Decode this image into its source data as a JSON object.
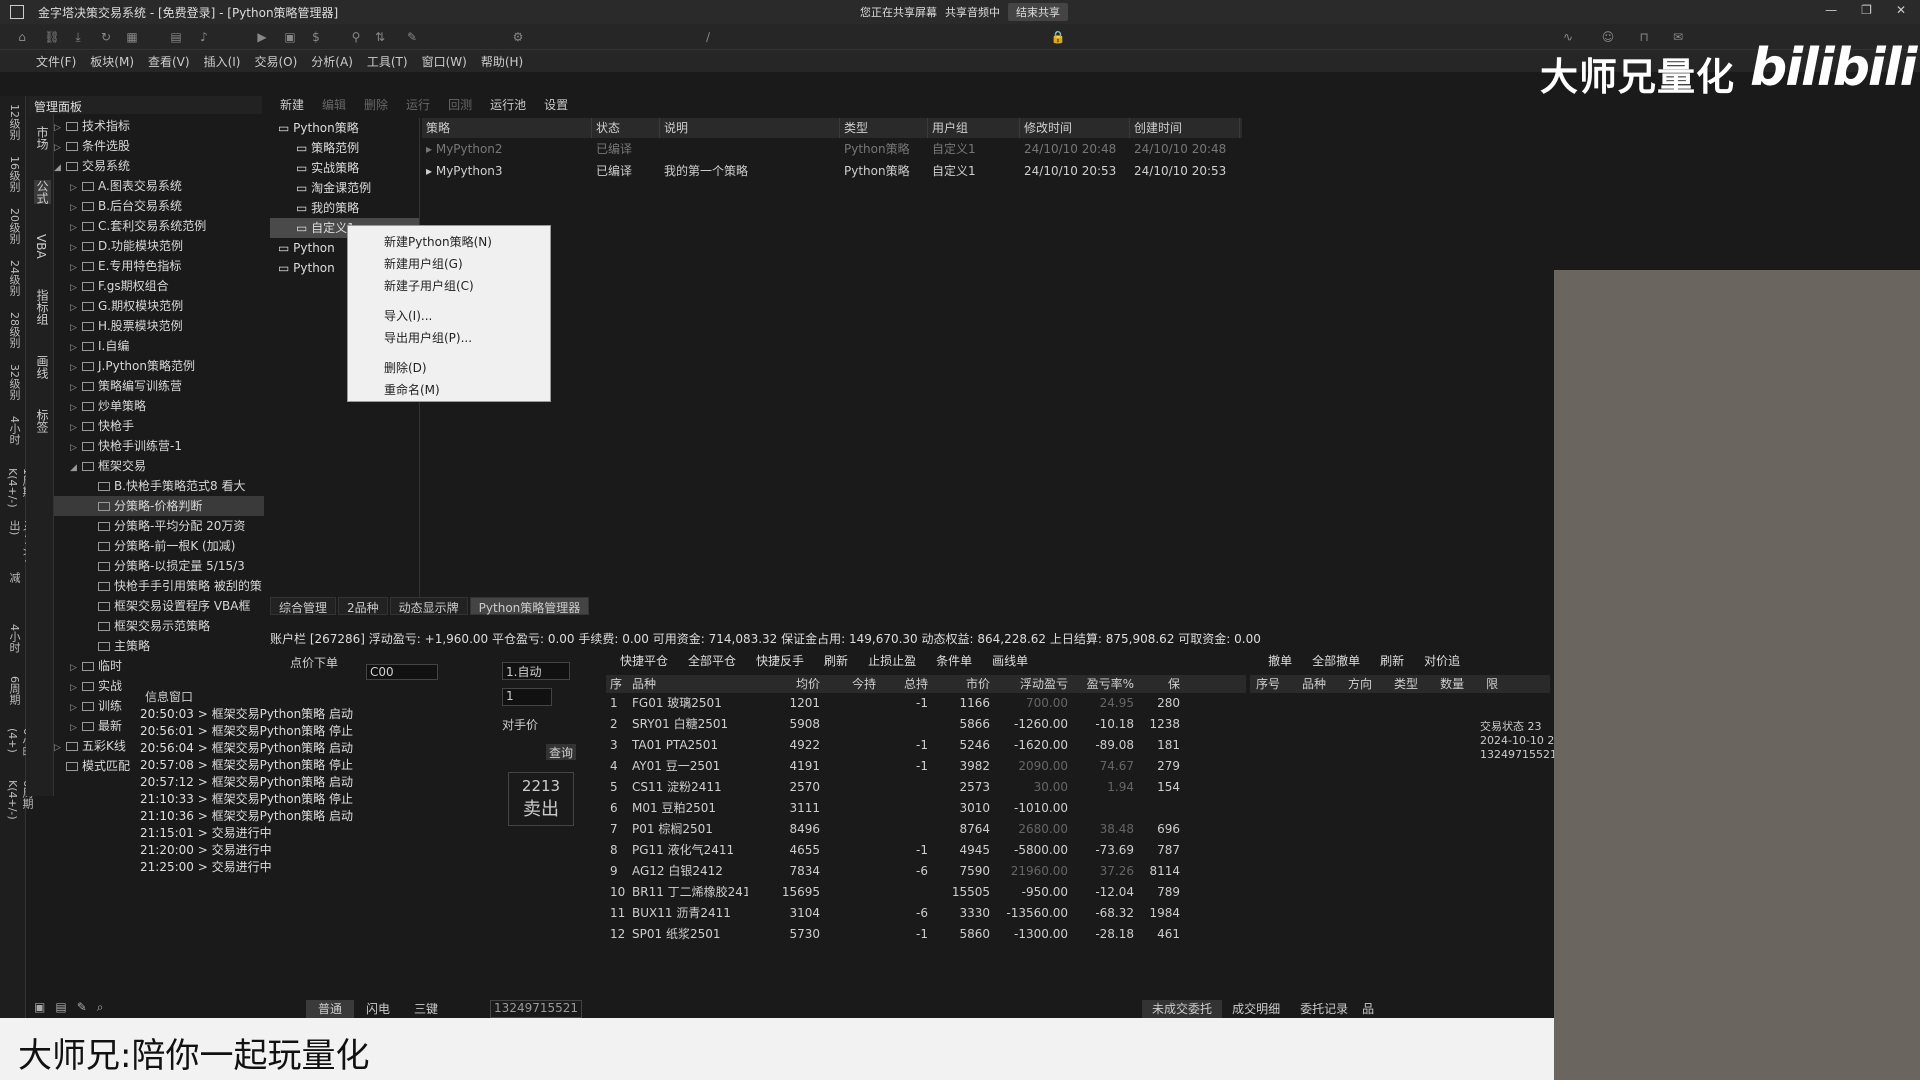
{
  "window": {
    "title": "金字塔决策交易系统 - [免费登录] - [Python策略管理器]"
  },
  "share": {
    "screen": "您正在共享屏幕",
    "audio": "共享音频中",
    "stop": "结束共享"
  },
  "menu": [
    "文件(F)",
    "板块(M)",
    "查看(V)",
    "插入(I)",
    "交易(O)",
    "分析(A)",
    "工具(T)",
    "窗口(W)",
    "帮助(H)"
  ],
  "brand": {
    "name": "大师兄量化",
    "site": "bilibili"
  },
  "left_tabs": [
    "12级别",
    "16级别",
    "20级别",
    "24级别",
    "28级别",
    "32级别",
    "4小时",
    "1周期K(4+/-)",
    "1周期K(4+)(4出)",
    "4小时加减",
    "4小时",
    "6周期",
    "6小时(4+)",
    "6周期K(4+/-)"
  ],
  "panel_tabs": [
    "市场",
    "公式",
    "VBA",
    "指标组",
    "画线",
    "标签"
  ],
  "panel_header": "管理面板",
  "tree": [
    {
      "label": "技术指标",
      "depth": 1,
      "arrow": "▷"
    },
    {
      "label": "条件选股",
      "depth": 1,
      "arrow": "▷"
    },
    {
      "label": "交易系统",
      "depth": 1,
      "arrow": "◢"
    },
    {
      "label": "A.图表交易系统",
      "depth": 2,
      "arrow": "▷"
    },
    {
      "label": "B.后台交易系统",
      "depth": 2,
      "arrow": "▷"
    },
    {
      "label": "C.套利交易系统范例",
      "depth": 2,
      "arrow": "▷"
    },
    {
      "label": "D.功能模块范例",
      "depth": 2,
      "arrow": "▷"
    },
    {
      "label": "E.专用特色指标",
      "depth": 2,
      "arrow": "▷"
    },
    {
      "label": "F.gs期权组合",
      "depth": 2,
      "arrow": "▷"
    },
    {
      "label": "G.期权模块范例",
      "depth": 2,
      "arrow": "▷"
    },
    {
      "label": "H.股票模块范例",
      "depth": 2,
      "arrow": "▷"
    },
    {
      "label": "I.自编",
      "depth": 2,
      "arrow": "▷"
    },
    {
      "label": "J.Python策略范例",
      "depth": 2,
      "arrow": "▷"
    },
    {
      "label": "策略编写训练营",
      "depth": 2,
      "arrow": "▷"
    },
    {
      "label": "炒单策略",
      "depth": 2,
      "arrow": "▷"
    },
    {
      "label": "快枪手",
      "depth": 2,
      "arrow": "▷"
    },
    {
      "label": "快枪手训练营-1",
      "depth": 2,
      "arrow": "▷"
    },
    {
      "label": "框架交易",
      "depth": 2,
      "arrow": "◢"
    },
    {
      "label": "B.快枪手策略范式8 看大",
      "depth": 3,
      "arrow": ""
    },
    {
      "label": "分策略-价格判断",
      "depth": 3,
      "arrow": "",
      "sel": true
    },
    {
      "label": "分策略-平均分配 20万资",
      "depth": 3,
      "arrow": ""
    },
    {
      "label": "分策略-前一根K (加减)",
      "depth": 3,
      "arrow": ""
    },
    {
      "label": "分策略-以损定量 5/15/3",
      "depth": 3,
      "arrow": ""
    },
    {
      "label": "快枪手手引用策略 被刮的策",
      "depth": 3,
      "arrow": ""
    },
    {
      "label": "框架交易设置程序 VBA框",
      "depth": 3,
      "arrow": ""
    },
    {
      "label": "框架交易示范策略",
      "depth": 3,
      "arrow": ""
    },
    {
      "label": "主策略",
      "depth": 3,
      "arrow": ""
    },
    {
      "label": "临时",
      "depth": 2,
      "arrow": "▷"
    },
    {
      "label": "实战",
      "depth": 2,
      "arrow": "▷"
    },
    {
      "label": "训练",
      "depth": 2,
      "arrow": "▷"
    },
    {
      "label": "最新",
      "depth": 2,
      "arrow": "▷"
    },
    {
      "label": "五彩K线",
      "depth": 1,
      "arrow": "▷"
    },
    {
      "label": "模式匹配",
      "depth": 1,
      "arrow": ""
    }
  ],
  "toolbar2": {
    "new": "新建",
    "edit": "编辑",
    "delete": "删除",
    "run": "运行",
    "backtest": "回测",
    "pool": "运行池",
    "settings": "设置"
  },
  "strategy_tree": [
    {
      "label": "Python策略",
      "depth": 0
    },
    {
      "label": "策略范例",
      "depth": 1
    },
    {
      "label": "实战策略",
      "depth": 1
    },
    {
      "label": "淘金课范例",
      "depth": 1
    },
    {
      "label": "我的策略",
      "depth": 1
    },
    {
      "label": "自定义1",
      "depth": 1,
      "sel": true
    },
    {
      "label": "Python",
      "depth": 0
    },
    {
      "label": "Python",
      "depth": 0
    }
  ],
  "strategy_table": {
    "headers": [
      "策略",
      "状态",
      "说明",
      "类型",
      "用户组",
      "修改时间",
      "创建时间"
    ],
    "rows": [
      {
        "cells": [
          "MyPython2",
          "已编译",
          "",
          "Python策略",
          "自定义1",
          "24/10/10 20:48",
          "24/10/10 20:48"
        ],
        "dim": true
      },
      {
        "cells": [
          "MyPython3",
          "已编译",
          "我的第一个策略",
          "Python策略",
          "自定义1",
          "24/10/10 20:53",
          "24/10/10 20:53"
        ],
        "dim": false
      }
    ]
  },
  "context_menu": [
    "新建Python策略(N)",
    "新建用户组(G)",
    "新建子用户组(C)",
    "-",
    "导入(I)...",
    "导出用户组(P)...",
    "-",
    "删除(D)",
    "重命名(M)"
  ],
  "bottom_tabs": [
    "综合管理",
    "2品种",
    "动态显示牌",
    "Python策略管理器"
  ],
  "account": "账户栏 [267286] 浮动盈亏: +1,960.00  平仓盈亏: 0.00  手续费: 0.00  可用资金: 714,083.32  保证金占用: 149,670.30  动态权益: 864,228.62  上日结算: 875,908.62  可取资金: 0.00",
  "order": {
    "label": "点价下单",
    "code": "C00",
    "mode": "1.自动",
    "qty": "1",
    "price_type": "对手价",
    "query": "查询",
    "price": "2213",
    "sell": "卖出"
  },
  "messages": {
    "title": "信息窗口",
    "lines": [
      "20:50:03 > 框架交易Python策略 启动",
      "20:56:01 > 框架交易Python策略 停止",
      "20:56:04 > 框架交易Python策略 启动",
      "20:57:08 > 框架交易Python策略 停止",
      "20:57:12 > 框架交易Python策略 启动",
      "21:10:33 > 框架交易Python策略 停止",
      "21:10:36 > 框架交易Python策略 启动",
      "21:15:01 > 交易进行中",
      "21:20:00 > 交易进行中",
      "21:25:00 > 交易进行中"
    ]
  },
  "position_toolbar": [
    "快捷平仓",
    "全部平仓",
    "快捷反手",
    "刷新",
    "止损止盈",
    "条件单",
    "画线单"
  ],
  "order_toolbar": [
    "撤单",
    "全部撤单",
    "刷新",
    "对价追"
  ],
  "position_headers": [
    "序",
    "品种",
    "均价",
    "今持",
    "总持",
    "市价",
    "浮动盈亏",
    "盈亏率%",
    "保"
  ],
  "positions": [
    [
      "1",
      "FG01 玻璃2501",
      "1201",
      "",
      "-1",
      "1166",
      "700.00",
      "24.95",
      "280"
    ],
    [
      "2",
      "SRY01 白糖2501",
      "5908",
      "",
      "",
      "5866",
      "-1260.00",
      "-10.18",
      "1238"
    ],
    [
      "3",
      "TA01 PTA2501",
      "4922",
      "",
      "-1",
      "5246",
      "-1620.00",
      "-89.08",
      "181"
    ],
    [
      "4",
      "AY01 豆一2501",
      "4191",
      "",
      "-1",
      "3982",
      "2090.00",
      "74.67",
      "279"
    ],
    [
      "5",
      "CS11 淀粉2411",
      "2570",
      "",
      "",
      "2573",
      "30.00",
      "1.94",
      "154"
    ],
    [
      "6",
      "M01 豆粕2501",
      "3111",
      "",
      "",
      "3010",
      "-1010.00",
      "",
      ""
    ],
    [
      "7",
      "P01 棕榈2501",
      "8496",
      "",
      "",
      "8764",
      "2680.00",
      "38.48",
      "696"
    ],
    [
      "8",
      "PG11 液化气2411",
      "4655",
      "",
      "-1",
      "4945",
      "-5800.00",
      "-73.69",
      "787"
    ],
    [
      "9",
      "AG12 白银2412",
      "7834",
      "",
      "-6",
      "7590",
      "21960.00",
      "37.26",
      "8114"
    ],
    [
      "10",
      "BR11 丁二烯橡胶2411",
      "15695",
      "",
      "",
      "15505",
      "-950.00",
      "-12.04",
      "789"
    ],
    [
      "11",
      "BUX11 沥青2411",
      "3104",
      "",
      "-6",
      "3330",
      "-13560.00",
      "-68.32",
      "1984"
    ],
    [
      "12",
      "SP01 纸浆2501",
      "5730",
      "",
      "-1",
      "5860",
      "-1300.00",
      "-28.18",
      "461"
    ]
  ],
  "order_headers": [
    "序号",
    "品种",
    "方向",
    "类型",
    "数量",
    "限"
  ],
  "trade_status": [
    "交易状态 23",
    "2024-10-10 2",
    "13249715521"
  ],
  "bottombar": {
    "tabs": [
      "普通",
      "闪电",
      "三键"
    ],
    "account": "13249715521",
    "right": [
      "未成交委托",
      "成交明细",
      "委托记录",
      "品"
    ]
  },
  "caption": "大师兄:陪你一起玩量化"
}
